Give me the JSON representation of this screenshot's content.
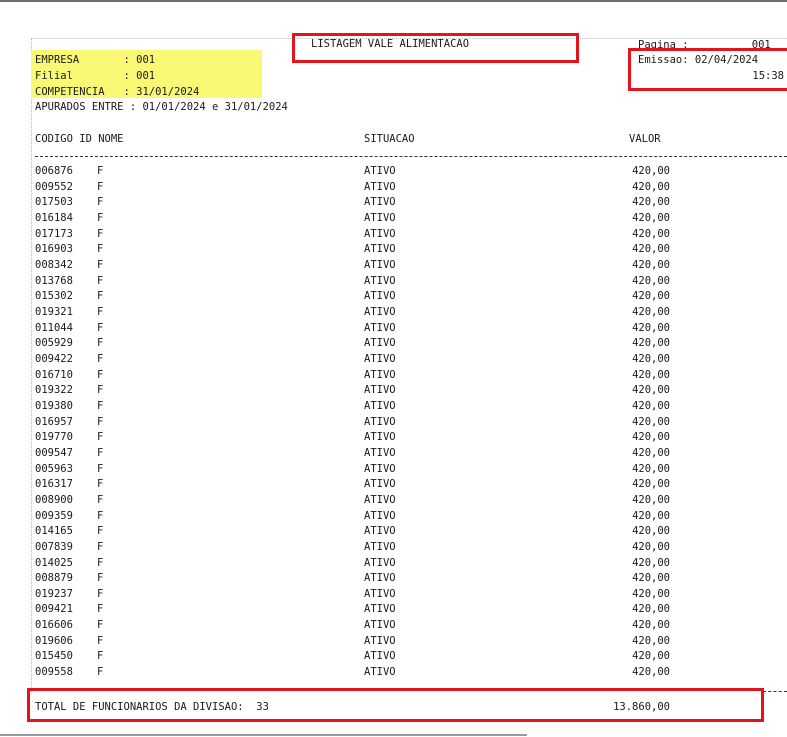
{
  "header": {
    "title": "LISTAGEM VALE ALIMENTACAO",
    "pagina": "Pagina :          001",
    "emissao": "Emissao: 02/04/2024",
    "hora": "15:38"
  },
  "info": {
    "empresa": "EMPRESA       : 001",
    "filial": "Filial        : 001",
    "competencia": "COMPETENCIA   : 31/01/2024",
    "apurados": "APURADOS ENTRE : 01/01/2024 e 31/01/2024"
  },
  "columns": {
    "codigo_id_nome": "CODIGO ID NOME",
    "situacao": "SITUACAO",
    "valor": "VALOR"
  },
  "rows": [
    {
      "codigo": "006876",
      "id": "F",
      "situacao": "ATIVO",
      "valor": "420,00"
    },
    {
      "codigo": "009552",
      "id": "F",
      "situacao": "ATIVO",
      "valor": "420,00"
    },
    {
      "codigo": "017503",
      "id": "F",
      "situacao": "ATIVO",
      "valor": "420,00"
    },
    {
      "codigo": "016184",
      "id": "F",
      "situacao": "ATIVO",
      "valor": "420,00"
    },
    {
      "codigo": "017173",
      "id": "F",
      "situacao": "ATIVO",
      "valor": "420,00"
    },
    {
      "codigo": "016903",
      "id": "F",
      "situacao": "ATIVO",
      "valor": "420,00"
    },
    {
      "codigo": "008342",
      "id": "F",
      "situacao": "ATIVO",
      "valor": "420,00"
    },
    {
      "codigo": "013768",
      "id": "F",
      "situacao": "ATIVO",
      "valor": "420,00"
    },
    {
      "codigo": "015302",
      "id": "F",
      "situacao": "ATIVO",
      "valor": "420,00"
    },
    {
      "codigo": "019321",
      "id": "F",
      "situacao": "ATIVO",
      "valor": "420,00"
    },
    {
      "codigo": "011044",
      "id": "F",
      "situacao": "ATIVO",
      "valor": "420,00"
    },
    {
      "codigo": "005929",
      "id": "F",
      "situacao": "ATIVO",
      "valor": "420,00"
    },
    {
      "codigo": "009422",
      "id": "F",
      "situacao": "ATIVO",
      "valor": "420,00"
    },
    {
      "codigo": "016710",
      "id": "F",
      "situacao": "ATIVO",
      "valor": "420,00"
    },
    {
      "codigo": "019322",
      "id": "F",
      "situacao": "ATIVO",
      "valor": "420,00"
    },
    {
      "codigo": "019380",
      "id": "F",
      "situacao": "ATIVO",
      "valor": "420,00"
    },
    {
      "codigo": "016957",
      "id": "F",
      "situacao": "ATIVO",
      "valor": "420,00"
    },
    {
      "codigo": "019770",
      "id": "F",
      "situacao": "ATIVO",
      "valor": "420,00"
    },
    {
      "codigo": "009547",
      "id": "F",
      "situacao": "ATIVO",
      "valor": "420,00"
    },
    {
      "codigo": "005963",
      "id": "F",
      "situacao": "ATIVO",
      "valor": "420,00"
    },
    {
      "codigo": "016317",
      "id": "F",
      "situacao": "ATIVO",
      "valor": "420,00"
    },
    {
      "codigo": "008900",
      "id": "F",
      "situacao": "ATIVO",
      "valor": "420,00"
    },
    {
      "codigo": "009359",
      "id": "F",
      "situacao": "ATIVO",
      "valor": "420,00"
    },
    {
      "codigo": "014165",
      "id": "F",
      "situacao": "ATIVO",
      "valor": "420,00"
    },
    {
      "codigo": "007839",
      "id": "F",
      "situacao": "ATIVO",
      "valor": "420,00"
    },
    {
      "codigo": "014025",
      "id": "F",
      "situacao": "ATIVO",
      "valor": "420,00"
    },
    {
      "codigo": "008879",
      "id": "F",
      "situacao": "ATIVO",
      "valor": "420,00"
    },
    {
      "codigo": "019237",
      "id": "F",
      "situacao": "ATIVO",
      "valor": "420,00"
    },
    {
      "codigo": "009421",
      "id": "F",
      "situacao": "ATIVO",
      "valor": "420,00"
    },
    {
      "codigo": "016606",
      "id": "F",
      "situacao": "ATIVO",
      "valor": "420,00"
    },
    {
      "codigo": "019606",
      "id": "F",
      "situacao": "ATIVO",
      "valor": "420,00"
    },
    {
      "codigo": "015450",
      "id": "F",
      "situacao": "ATIVO",
      "valor": "420,00"
    },
    {
      "codigo": "009558",
      "id": "F",
      "situacao": "ATIVO",
      "valor": "420,00"
    }
  ],
  "total": {
    "label": "TOTAL DE FUNCIONARIOS DA DIVISAO:  33",
    "valor": "13.860,00"
  },
  "colors": {
    "highlight": "#f9f976",
    "annotation_box": "#e3141a"
  }
}
